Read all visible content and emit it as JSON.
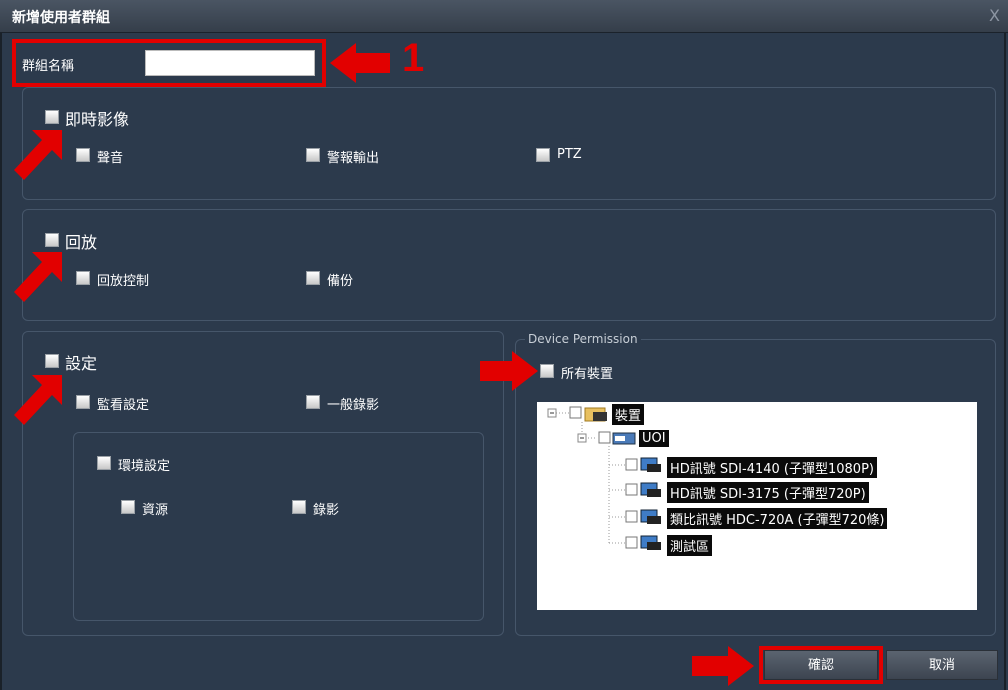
{
  "dialog": {
    "title": "新增使用者群組",
    "close_glyph": "X"
  },
  "group_name": {
    "label": "群組名稱",
    "value": ""
  },
  "annotation": {
    "step_number": "1",
    "accent_color": "#e20000"
  },
  "live_view": {
    "label": "即時影像",
    "options": [
      "聲音",
      "警報輸出",
      "PTZ"
    ]
  },
  "playback": {
    "label": "回放",
    "options": [
      "回放控制",
      "備份"
    ]
  },
  "settings": {
    "label": "設定",
    "options": [
      "監看設定",
      "一般錄影"
    ],
    "env": {
      "label": "環境設定",
      "options": [
        "資源",
        "錄影"
      ]
    }
  },
  "device_permission": {
    "legend": "Device Permission",
    "all_devices": "所有裝置",
    "tree": {
      "root": "裝置",
      "group": "UOI",
      "devices": [
        "HD訊號  SDI-4140 (子彈型1080P)",
        "HD訊號  SDI-3175 (子彈型720P)",
        "類比訊號  HDC-720A (子彈型720條)",
        "測試區"
      ]
    }
  },
  "buttons": {
    "confirm": "確認",
    "cancel": "取消"
  }
}
